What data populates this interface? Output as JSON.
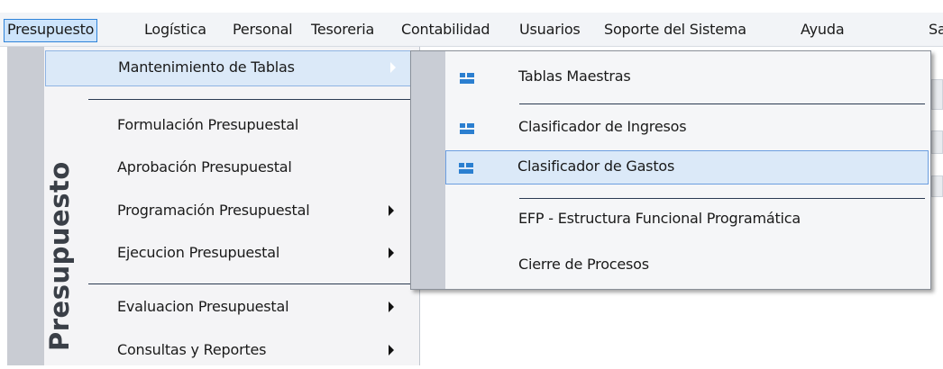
{
  "menubar": {
    "items": [
      {
        "label": "Presupuesto",
        "active": true
      },
      {
        "label": "Logística"
      },
      {
        "label": "Personal"
      },
      {
        "label": "Tesoreria"
      },
      {
        "label": "Contabilidad"
      },
      {
        "label": "Usuarios"
      },
      {
        "label": "Soporte del Sistema"
      },
      {
        "label": "Ayuda"
      },
      {
        "label": "Sa"
      }
    ]
  },
  "presupuesto_menu": {
    "side_label": "Presupuesto",
    "items": [
      {
        "label": "Mantenimiento de Tablas",
        "submenu": true,
        "highlighted": true
      },
      {
        "label": "Formulación Presupuestal"
      },
      {
        "label": "Aprobación Presupuestal"
      },
      {
        "label": "Programación Presupuestal",
        "submenu": true
      },
      {
        "label": "Ejecucion Presupuestal",
        "submenu": true
      },
      {
        "label": "Evaluacion Presupuestal",
        "submenu": true
      },
      {
        "label": "Consultas y Reportes",
        "submenu": true
      }
    ]
  },
  "tablas_submenu": {
    "items": [
      {
        "label": "Tablas Maestras",
        "icon": "table-icon"
      },
      {
        "label": "Clasificador de Ingresos",
        "icon": "table-icon"
      },
      {
        "label": "Clasificador de Gastos",
        "icon": "table-icon",
        "highlighted": true
      },
      {
        "label": "EFP - Estructura Funcional Programática"
      },
      {
        "label": "Cierre de Procesos"
      }
    ]
  },
  "colors": {
    "active_menu_bg": "#cde4fb",
    "active_menu_border": "#2f83d9",
    "highlight_bg": "#dbe9f8",
    "icon_blue": "#2b7fd0"
  }
}
